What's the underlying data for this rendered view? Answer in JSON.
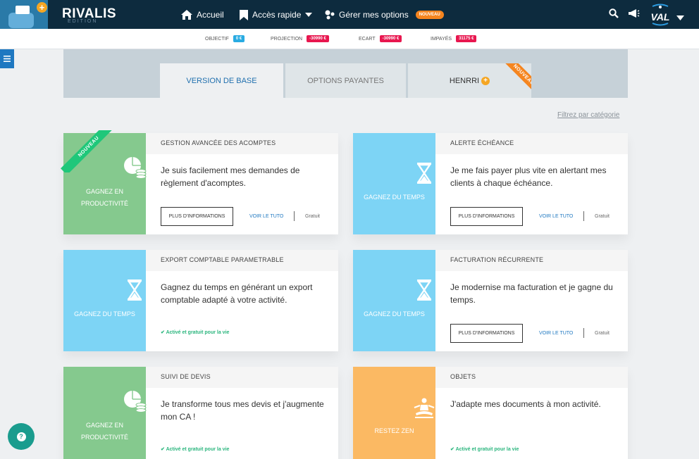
{
  "brand": {
    "name": "RIVALIS",
    "sub": "EDITION"
  },
  "nav": {
    "home": "Accueil",
    "quick": "Accès rapide",
    "options": "Gérer mes options",
    "options_badge": "NOUVEAU"
  },
  "user": {
    "initials": "VAL"
  },
  "stats": [
    {
      "label": "OBJECTIF",
      "value": "0 €",
      "color": "#29abe2"
    },
    {
      "label": "PROJECTION",
      "value": "-30990 €",
      "color": "#e8174f"
    },
    {
      "label": "ECART",
      "value": "-30990 €",
      "color": "#e8174f"
    },
    {
      "label": "IMPAYÉS",
      "value": "31175 €",
      "color": "#e8174f"
    }
  ],
  "tabs": [
    {
      "label": "VERSION DE BASE"
    },
    {
      "label": "OPTIONS PAYANTES"
    },
    {
      "label": "HENRRI",
      "ribbon": "NOUVEAU"
    }
  ],
  "filter_link": "Filtrez par catégorie",
  "cards": [
    {
      "title": "GESTION AVANCÉE DES ACOMPTES",
      "category": [
        "GAGNEZ EN",
        "PRODUCTIVITÉ"
      ],
      "color": "#85c98e",
      "icon": "pie-coins-icon",
      "description": "Je suis facilement mes demandes de règlement d'acomptes.",
      "ribbon": "NOUVEAU",
      "info_button": "PLUS D'INFORMATIONS",
      "tuto": "VOIR LE TUTO",
      "price": "Gratuit"
    },
    {
      "title": "ALERTE ÉCHÉANCE",
      "category": [
        "GAGNEZ DU TEMPS"
      ],
      "color": "#7dd4f5",
      "icon": "hourglass-icon",
      "description": "Je me fais payer plus vite en alertant mes clients à chaque échéance.",
      "info_button": "PLUS D'INFORMATIONS",
      "tuto": "VOIR LE TUTO",
      "price": "Gratuit"
    },
    {
      "title": "EXPORT COMPTABLE PARAMETRABLE",
      "category": [
        "GAGNEZ DU TEMPS"
      ],
      "color": "#7dd4f5",
      "icon": "hourglass-icon",
      "description": "Gagnez du temps en générant un export comptable adapté à votre activité.",
      "active": "Activé et gratuit pour la vie"
    },
    {
      "title": "FACTURATION RÉCURRENTE",
      "category": [
        "GAGNEZ DU TEMPS"
      ],
      "color": "#7dd4f5",
      "icon": "hourglass-icon",
      "description": "Je modernise ma facturation et je gagne du temps.",
      "info_button": "PLUS D'INFORMATIONS",
      "tuto": "VOIR LE TUTO",
      "price": "Gratuit"
    },
    {
      "title": "SUIVI DE DEVIS",
      "category": [
        "GAGNEZ EN",
        "PRODUCTIVITÉ"
      ],
      "color": "#85c98e",
      "icon": "pie-coins-icon",
      "description": "Je transforme tous mes devis et j'augmente mon CA !",
      "active": "Activé et gratuit pour la vie"
    },
    {
      "title": "OBJETS",
      "category": [
        "RESTEZ ZEN"
      ],
      "color": "#fbb963",
      "icon": "meditation-icon",
      "description": "J'adapte mes documents à mon activité.",
      "active": "Activé et gratuit pour la vie"
    }
  ]
}
